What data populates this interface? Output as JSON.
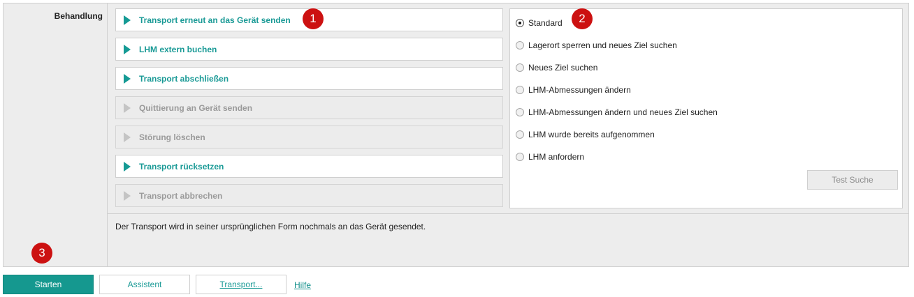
{
  "section": {
    "label": "Behandlung"
  },
  "actions": [
    {
      "label": "Transport erneut an das Gerät senden",
      "enabled": true
    },
    {
      "label": "LHM extern buchen",
      "enabled": true
    },
    {
      "label": "Transport abschließen",
      "enabled": true
    },
    {
      "label": "Quittierung an Gerät senden",
      "enabled": false
    },
    {
      "label": "Störung löschen",
      "enabled": false
    },
    {
      "label": "Transport rücksetzen",
      "enabled": true
    },
    {
      "label": "Transport abbrechen",
      "enabled": false
    }
  ],
  "options": [
    {
      "label": "Standard",
      "checked": true
    },
    {
      "label": "Lagerort sperren und neues Ziel suchen",
      "checked": false
    },
    {
      "label": "Neues Ziel suchen",
      "checked": false
    },
    {
      "label": "LHM-Abmessungen ändern",
      "checked": false
    },
    {
      "label": "LHM-Abmessungen ändern und neues Ziel suchen",
      "checked": false
    },
    {
      "label": "LHM wurde bereits aufgenommen",
      "checked": false
    },
    {
      "label": "LHM anfordern",
      "checked": false
    }
  ],
  "test_search": {
    "label": "Test Suche",
    "enabled": false
  },
  "description": "Der Transport wird in seiner ursprünglichen Form nochmals an das Gerät gesendet.",
  "badges": [
    "1",
    "2",
    "3"
  ],
  "footer": {
    "start": "Starten",
    "assistant": "Assistent",
    "transport": "Transport...",
    "help": "Hilfe"
  },
  "colors": {
    "accent": "#15988f",
    "badge": "#cc1111",
    "panel_bg": "#ededed",
    "disabled_text": "#9a9a9a"
  }
}
